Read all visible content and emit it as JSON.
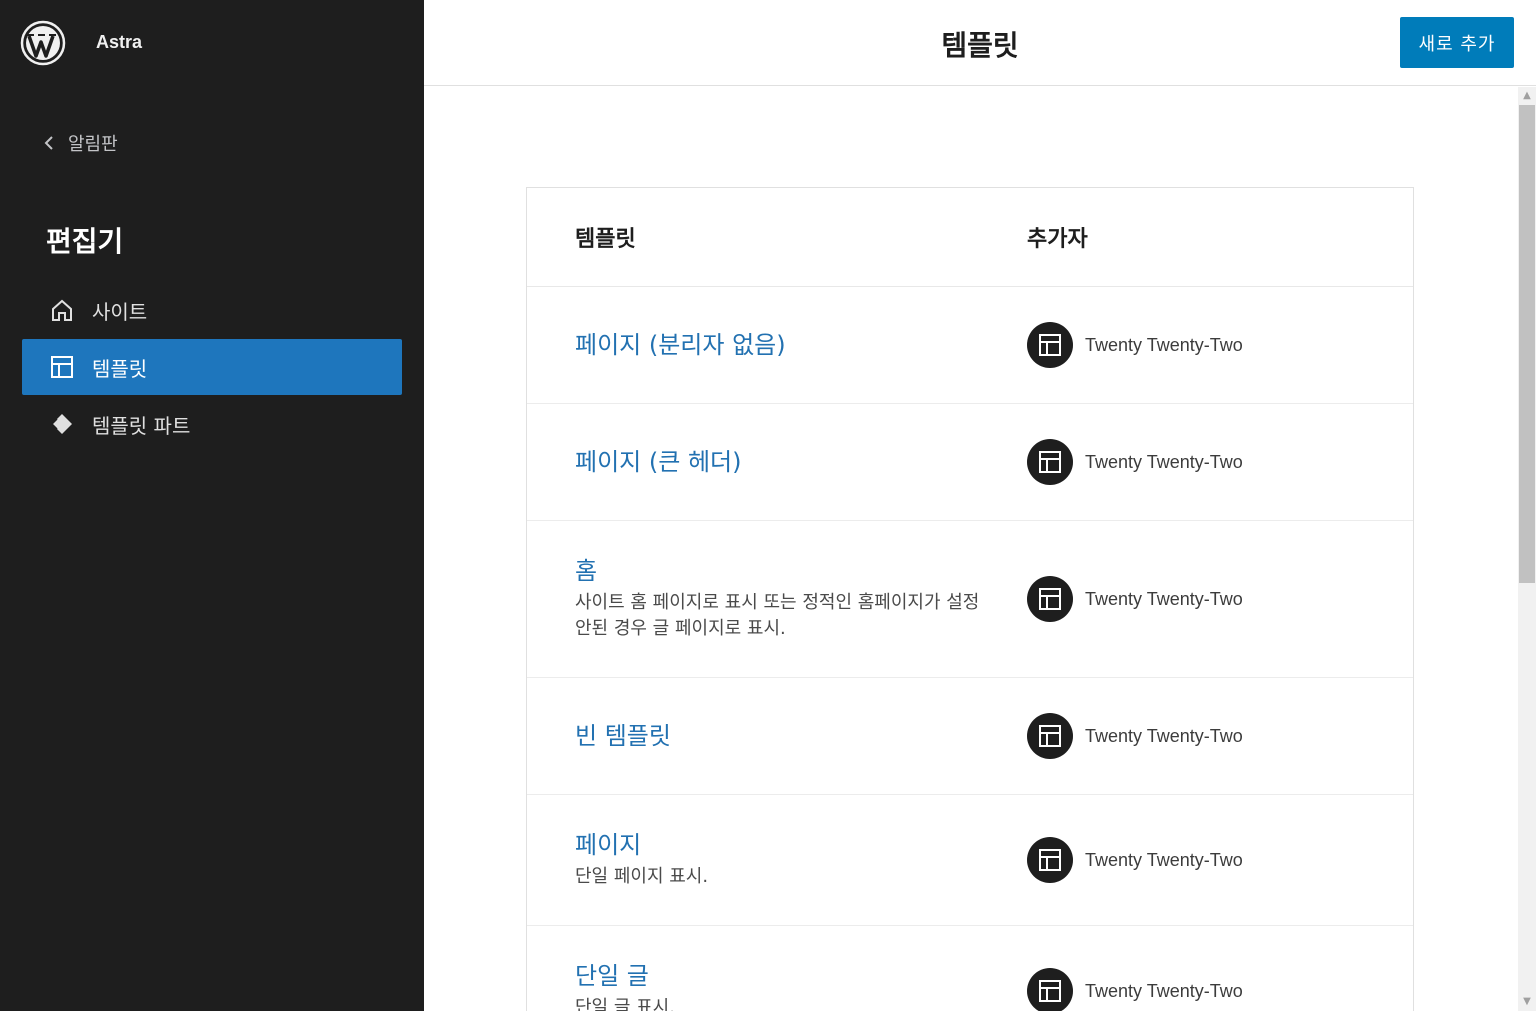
{
  "sidebar": {
    "site_name": "Astra",
    "back_label": "알림판",
    "editor_title": "편집기",
    "nav": [
      {
        "label": "사이트",
        "icon": "home-icon",
        "active": false
      },
      {
        "label": "템플릿",
        "icon": "layout-icon",
        "active": true
      },
      {
        "label": "템플릿 파트",
        "icon": "diamond-icon",
        "active": false
      }
    ]
  },
  "header": {
    "title": "템플릿",
    "add_new_label": "새로 추가"
  },
  "table": {
    "columns": [
      "템플릿",
      "추가자"
    ],
    "rows": [
      {
        "title": "페이지 (분리자 없음)",
        "desc": "",
        "added_by": "Twenty Twenty-Two"
      },
      {
        "title": "페이지 (큰 헤더)",
        "desc": "",
        "added_by": "Twenty Twenty-Two"
      },
      {
        "title": "홈",
        "desc": "사이트 홈 페이지로 표시 또는 정적인 홈페이지가 설정 안된 경우 글 페이지로 표시.",
        "added_by": "Twenty Twenty-Two"
      },
      {
        "title": "빈 템플릿",
        "desc": "",
        "added_by": "Twenty Twenty-Two"
      },
      {
        "title": "페이지",
        "desc": "단일 페이지 표시.",
        "added_by": "Twenty Twenty-Two"
      },
      {
        "title": "단일 글",
        "desc": "단일 글 표시.",
        "added_by": "Twenty Twenty-Two"
      }
    ]
  },
  "colors": {
    "sidebar_bg": "#1e1e1e",
    "accent": "#007cba",
    "link": "#2271b1"
  }
}
